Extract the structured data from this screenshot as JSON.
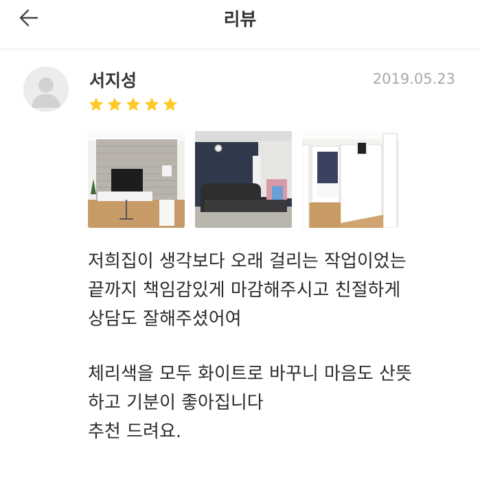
{
  "header": {
    "title": "리뷰",
    "back_icon": "arrow-left-icon"
  },
  "review": {
    "reviewer_name": "서지성",
    "date": "2019.05.23",
    "rating": 5,
    "max_rating": 5,
    "star_color": "#FFC928",
    "photos": [
      {
        "subject": "living room with TV wall"
      },
      {
        "subject": "dark leather sofa"
      },
      {
        "subject": "hallway to bedroom"
      }
    ],
    "body": {
      "p1": [
        "저희집이 생각보다 오래 걸리는 작업이었는",
        "끝까지 책임감있게 마감해주시고 친절하게",
        "상담도 잘해주셨어여"
      ],
      "p2": [
        "체리색을 모두 화이트로 바꾸니 마음도 산뜻",
        "하고 기분이 좋아집니다",
        "추천 드려요."
      ]
    }
  }
}
